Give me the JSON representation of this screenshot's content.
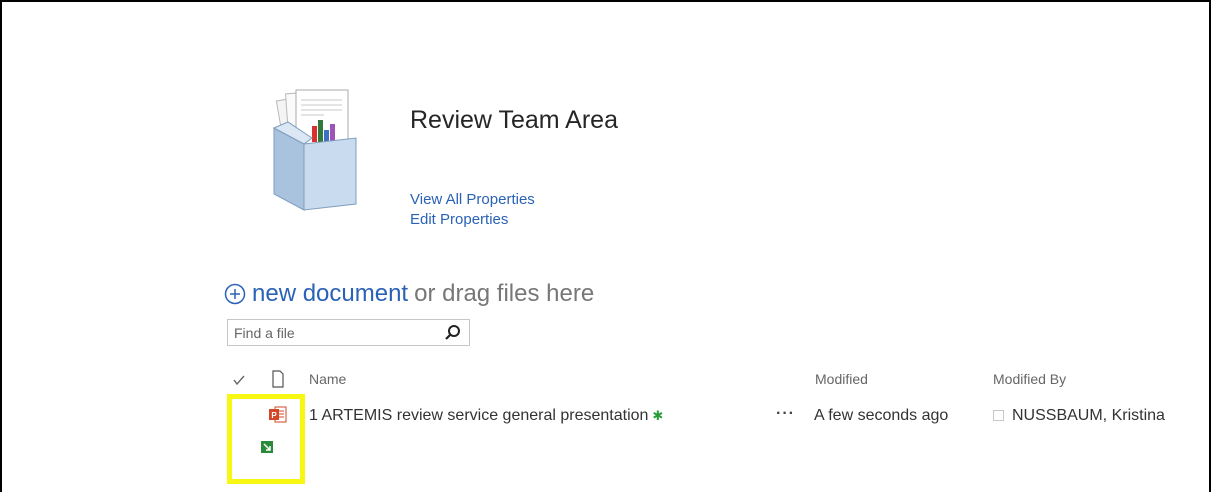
{
  "header": {
    "title": "Review Team Area",
    "view_all_properties": "View All Properties",
    "edit_properties": "Edit Properties"
  },
  "toolbar": {
    "new_document_label": "new document",
    "drag_text": "or drag files here"
  },
  "search": {
    "placeholder": "Find a file"
  },
  "columns": {
    "name": "Name",
    "modified": "Modified",
    "modified_by": "Modified By"
  },
  "files": [
    {
      "name": "1 ARTEMIS review service general presentation",
      "new_badge": "✱",
      "menu": "···",
      "modified": "A few seconds ago",
      "modified_by": "NUSSBAUM, Kristina",
      "file_icon": "powerpoint-icon"
    }
  ],
  "icons": {
    "doc_set": "document-set-icon",
    "plus": "plus-circle-icon",
    "search": "search-icon",
    "check": "checkmark-icon",
    "file_type": "file-type-icon",
    "sync": "sync-arrow-icon"
  },
  "colors": {
    "link": "#2a62b6",
    "new_badge": "#2a9d38",
    "highlight": "#f7f712",
    "powerpoint": "#d24726"
  }
}
